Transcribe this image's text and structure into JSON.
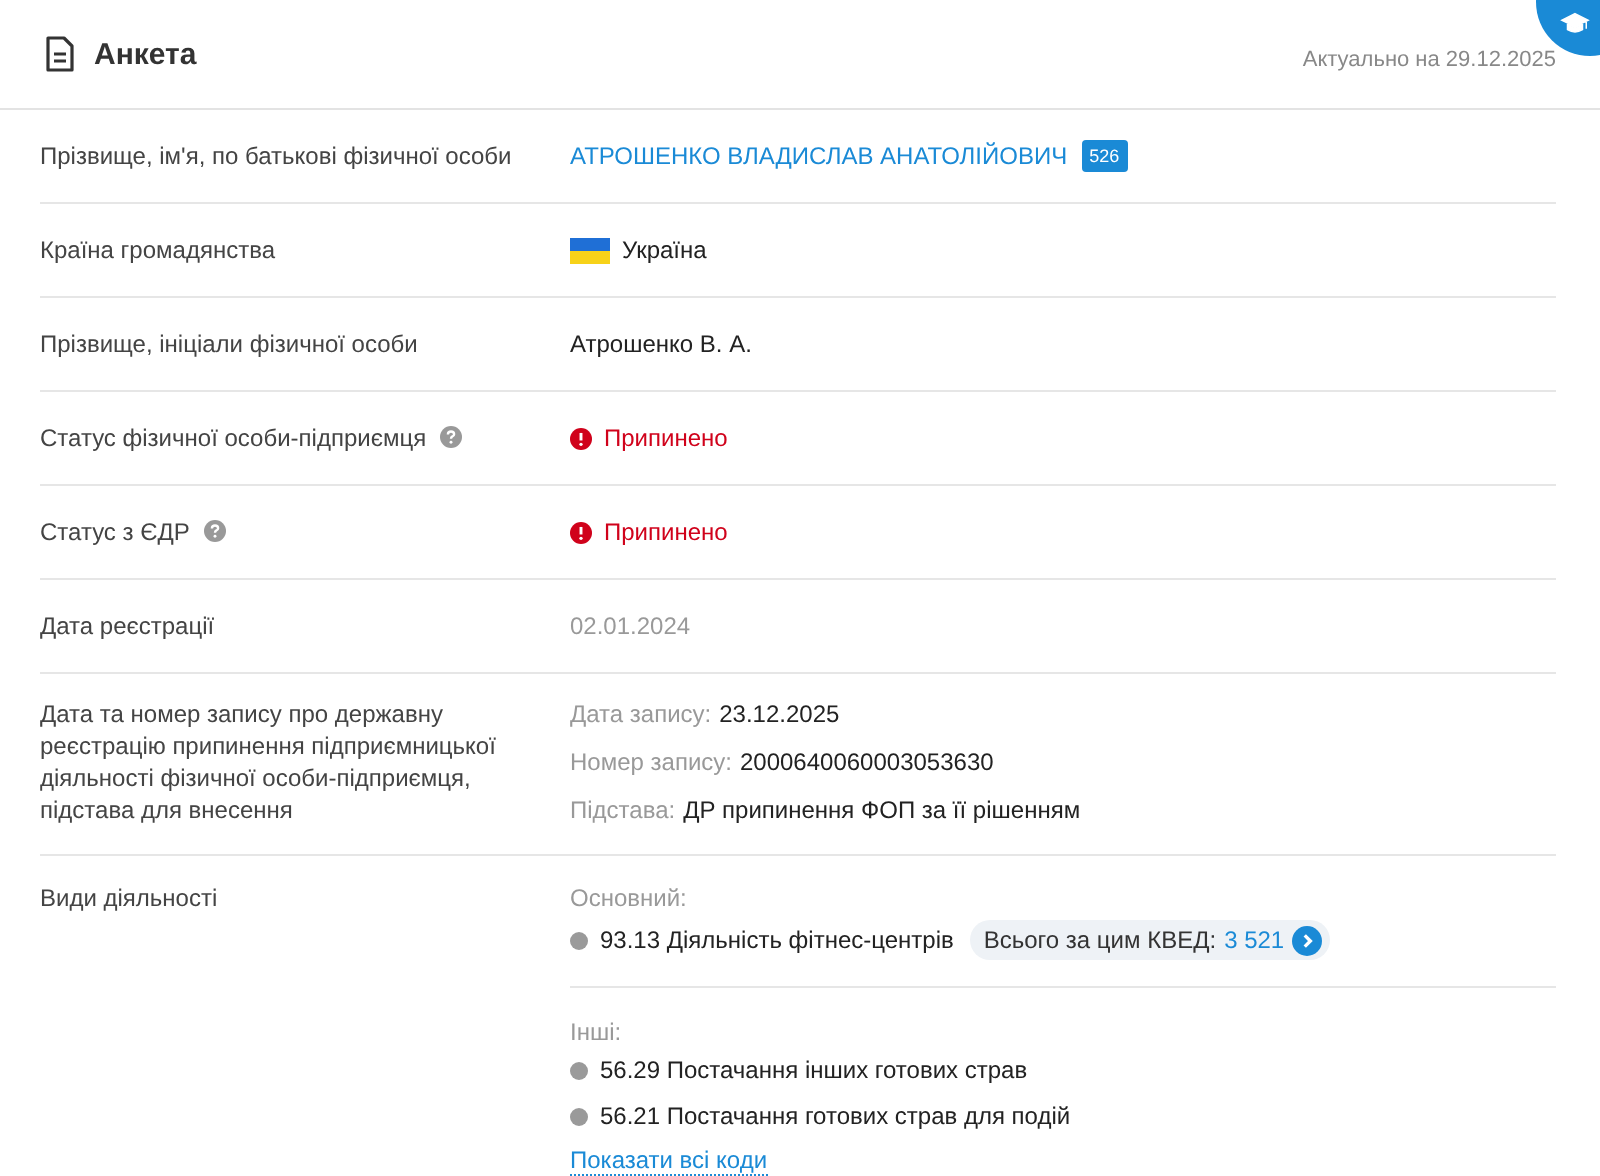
{
  "header": {
    "title": "Анкета",
    "actual": "Актуально на 29.12.2025"
  },
  "rows": [
    {
      "kind": "name",
      "label": "Прізвище, ім'я, по батькові фізичної особи",
      "help": false,
      "value": "АТРОШЕНКО ВЛАДИСЛАВ АНАТОЛІЙОВИЧ",
      "badge": "526"
    },
    {
      "kind": "country",
      "label": "Країна громадянства",
      "help": false,
      "value": "Україна"
    },
    {
      "kind": "text",
      "label": "Прізвище, ініціали фізичної особи",
      "help": false,
      "value": "Атрошенко В. А."
    },
    {
      "kind": "status",
      "label": "Статус фізичної особи-підприємця",
      "help": true,
      "value": "Припинено"
    },
    {
      "kind": "status",
      "label": "Статус з ЄДР",
      "help": true,
      "value": "Припинено"
    },
    {
      "kind": "muted",
      "label": "Дата реєстрації",
      "help": false,
      "value": "02.01.2024"
    },
    {
      "kind": "record",
      "label": "Дата та номер запису про державну реєстрацію припинення підприємницької діяльності фізичної особи-підприємця, підстава для внесення",
      "help": false,
      "lines": [
        {
          "key": "Дата запису:",
          "value": "23.12.2025"
        },
        {
          "key": "Номер запису:",
          "value": "2000640060003053630"
        },
        {
          "key": "Підстава:",
          "value": "ДР припинення ФОП за її рішенням"
        }
      ]
    },
    {
      "kind": "activities",
      "label": "Види діяльності",
      "help": false,
      "main_title": "Основний:",
      "main": [
        {
          "text": "93.13 Діяльність фітнес-центрів",
          "total_label": "Всього за цим КВЕД:",
          "total": "3 521"
        }
      ],
      "other_title": "Інші:",
      "other": [
        "56.29 Постачання інших готових страв",
        "56.21 Постачання готових страв для подій"
      ],
      "link": "Показати всі коди"
    }
  ]
}
